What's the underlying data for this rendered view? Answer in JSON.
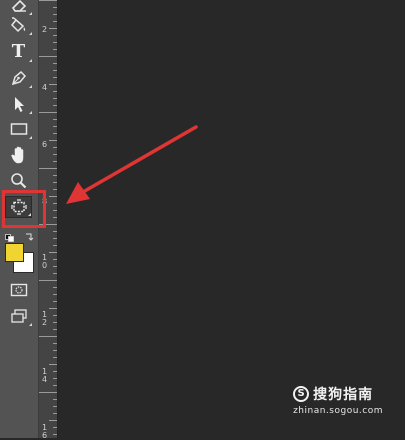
{
  "toolbar": {
    "tools": [
      {
        "name": "eraser-tool",
        "icon": "eraser-icon"
      },
      {
        "name": "paint-bucket-tool",
        "icon": "paint-bucket-icon"
      },
      {
        "name": "type-tool",
        "icon": "type-icon",
        "label": "T"
      },
      {
        "name": "pen-tool",
        "icon": "pen-icon"
      },
      {
        "name": "path-selection-tool",
        "icon": "arrow-cursor-icon"
      },
      {
        "name": "rectangle-tool",
        "icon": "rectangle-icon"
      },
      {
        "name": "hand-tool",
        "icon": "hand-icon"
      },
      {
        "name": "zoom-tool",
        "icon": "magnifier-icon"
      },
      {
        "name": "artboard-tool",
        "icon": "artboard-icon",
        "selected": true
      },
      {
        "name": "quick-mask-button",
        "icon": "quick-mask-icon"
      },
      {
        "name": "screen-mode-button",
        "icon": "screen-mode-icon"
      }
    ],
    "foreground_color": "#f0d431",
    "background_color": "#ffffff"
  },
  "ruler": {
    "labels": [
      "2",
      "4",
      "6",
      "8",
      "1\n0",
      "1\n2",
      "1\n4",
      "1\n6"
    ]
  },
  "annotation": {
    "highlight_color": "#e03535",
    "arrow_color": "#e03535"
  },
  "watermark": {
    "logo_letter": "S",
    "brand": "搜狗指南",
    "url": "zhinan.sogou.com"
  }
}
